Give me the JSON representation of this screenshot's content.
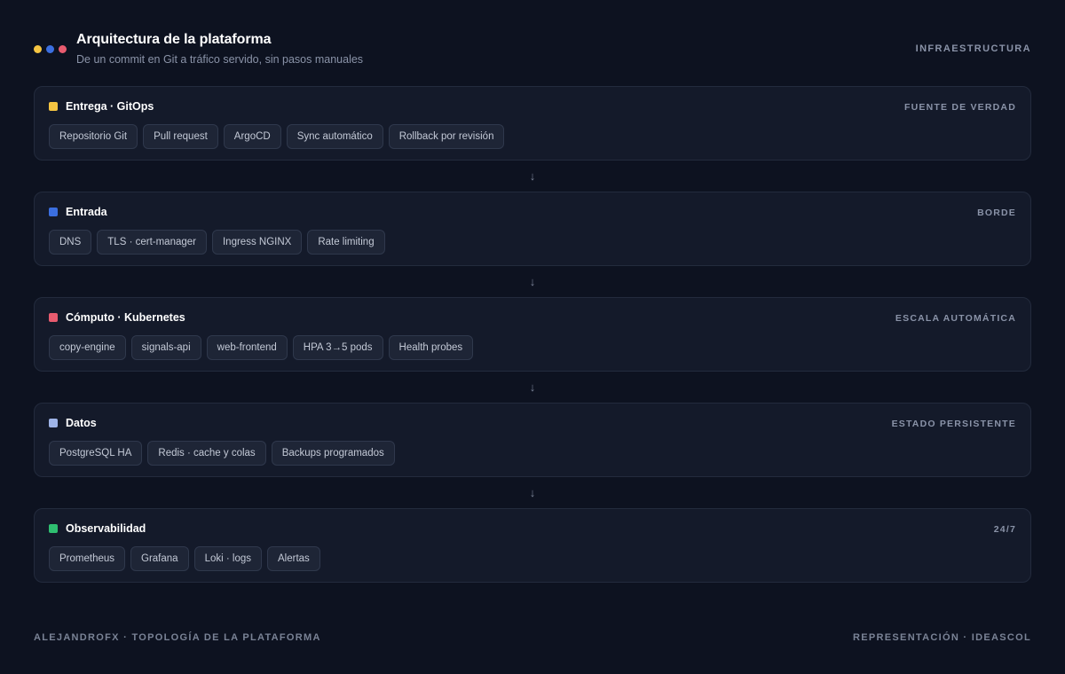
{
  "header": {
    "title": "Arquitectura de la plataforma",
    "subtitle": "De un commit en Git a tráfico servido, sin pasos manuales",
    "tag": "INFRAESTRUCTURA",
    "dot_colors": [
      "#f5c542",
      "#3b6fe0",
      "#e85b6f"
    ]
  },
  "arrow_glyph": "↓",
  "layers": [
    {
      "name": "Entrega · GitOps",
      "tag": "FUENTE DE VERDAD",
      "color": "#f5c542",
      "chips": [
        "Repositorio Git",
        "Pull request",
        "ArgoCD",
        "Sync automático",
        "Rollback por revisión"
      ]
    },
    {
      "name": "Entrada",
      "tag": "BORDE",
      "color": "#3b6fe0",
      "chips": [
        "DNS",
        "TLS · cert-manager",
        "Ingress NGINX",
        "Rate limiting"
      ]
    },
    {
      "name": "Cómputo · Kubernetes",
      "tag": "ESCALA AUTOMÁTICA",
      "color": "#e85b6f",
      "chips": [
        "copy-engine",
        "signals-api",
        "web-frontend",
        "HPA 3→5 pods",
        "Health probes"
      ]
    },
    {
      "name": "Datos",
      "tag": "ESTADO PERSISTENTE",
      "color": "#9fb4e8",
      "chips": [
        "PostgreSQL HA",
        "Redis · cache y colas",
        "Backups programados"
      ]
    },
    {
      "name": "Observabilidad",
      "tag": "24/7",
      "color": "#2fbf71",
      "chips": [
        "Prometheus",
        "Grafana",
        "Loki · logs",
        "Alertas"
      ]
    }
  ],
  "footer": {
    "left": "ALEJANDROFX · TOPOLOGÍA DE LA PLATAFORMA",
    "right": "REPRESENTACIÓN · IDEASCOL"
  }
}
